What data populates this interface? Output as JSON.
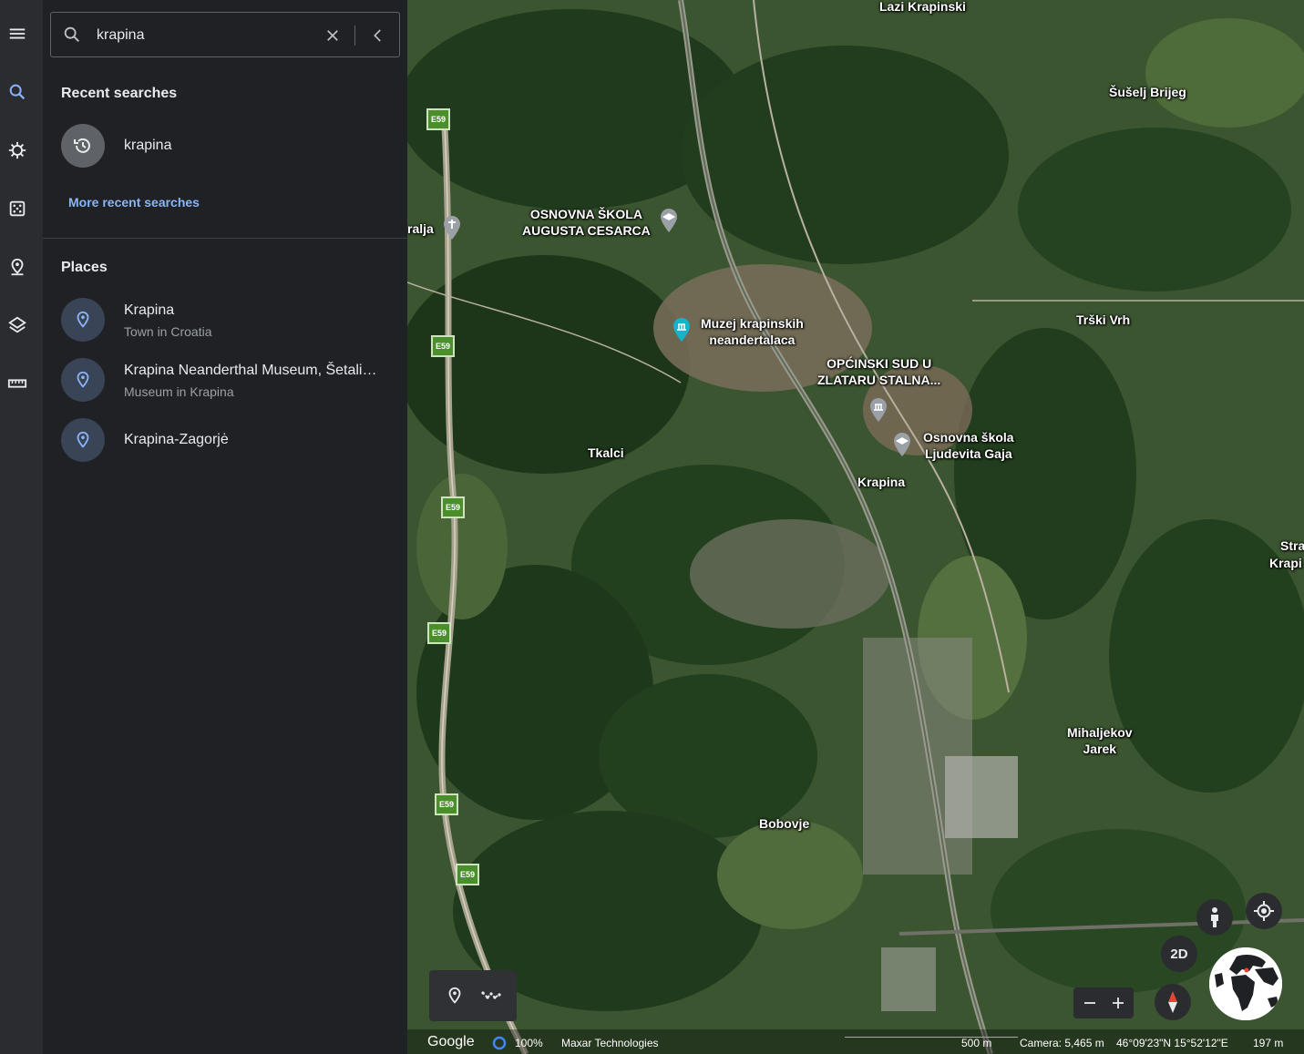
{
  "rail": {
    "items": [
      {
        "name": "menu-icon"
      },
      {
        "name": "search-icon"
      },
      {
        "name": "voyager-icon"
      },
      {
        "name": "feeling-lucky-icon"
      },
      {
        "name": "projects-icon"
      },
      {
        "name": "map-style-icon"
      },
      {
        "name": "measure-icon"
      }
    ]
  },
  "search": {
    "value": "krapina"
  },
  "recent": {
    "title": "Recent searches",
    "items": [
      {
        "label": "krapina"
      }
    ],
    "more_label": "More recent searches"
  },
  "places": {
    "title": "Places",
    "items": [
      {
        "title": "Krapina",
        "subtitle": "Town in Croatia"
      },
      {
        "title": "Krapina Neanderthal Museum, Šetali…",
        "subtitle": "Museum in Krapina"
      },
      {
        "title": "Krapina-Zagorjė",
        "subtitle": ""
      }
    ]
  },
  "map": {
    "labels": {
      "lazi": "Lazi Krapinski",
      "suselj": "Šušelj Brijeg",
      "ralja": "ralja",
      "osnovna1_l1": "OSNOVNA ŠKOLA",
      "osnovna1_l2": "AUGUSTA CESARCA",
      "muzej_l1": "Muzej krapinskih",
      "muzej_l2": "neandertalaca",
      "opcinski_l1": "OPĆINSKI SUD U",
      "opcinski_l2": "ZLATARU STALNA...",
      "trski": "Trški Vrh",
      "osnovna2_l1": "Osnovna škola",
      "osnovna2_l2": "Ljudevita Gaja",
      "tkalci": "Tkalci",
      "krapina": "Krapina",
      "stra": "Stra",
      "krapi": "Krapi",
      "mihaljekov_l1": "Mihaljekov",
      "mihaljekov_l2": "Jarek",
      "bobovje": "Bobovje"
    },
    "road_shield": "E59",
    "controls": {
      "mode_2d": "2D"
    }
  },
  "status": {
    "brand": "Google",
    "load_percent": "100%",
    "imagery": "Maxar Technologies",
    "scale": "500 m",
    "camera": "Camera: 5,465 m",
    "coords": "46°09'23\"N 15°52'12\"E",
    "elevation": "197 m"
  },
  "colors": {
    "accent_blue": "#8ab4f8",
    "panel_bg": "#202124",
    "rail_bg": "#2b2c2f",
    "place_icon_bg": "#394457",
    "history_icon_bg": "#5f6368",
    "compass_red": "#ea4335"
  }
}
